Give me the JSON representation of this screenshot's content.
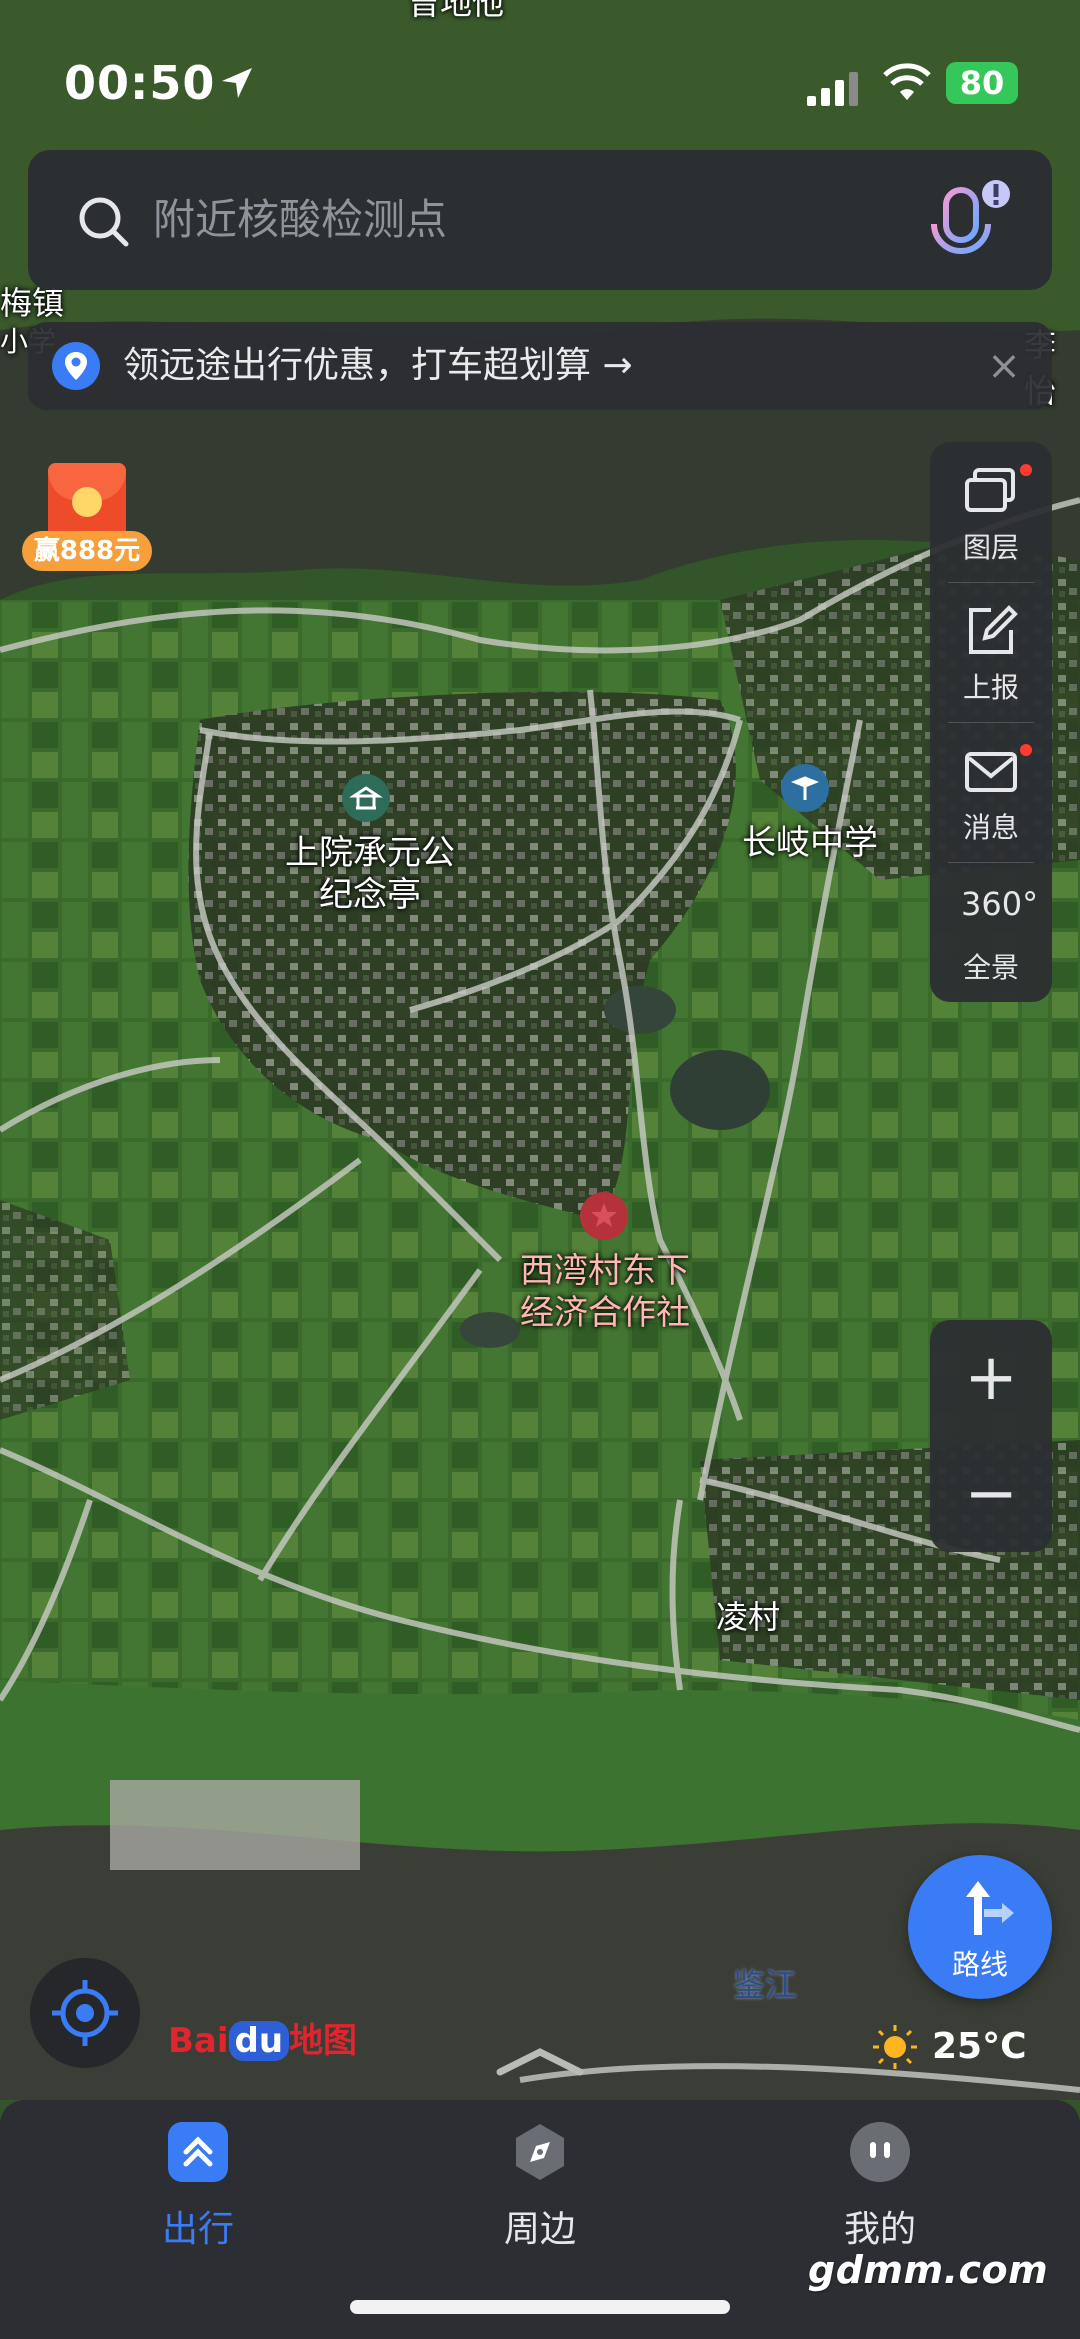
{
  "status_bar": {
    "time": "00:50",
    "battery": "80"
  },
  "search": {
    "placeholder": "附近核酸检测点"
  },
  "promo": {
    "text": "领远途出行优惠，打车超划算 →",
    "close": "×"
  },
  "redpacket": {
    "label": "赢888元"
  },
  "map_tools": [
    {
      "label": "图层",
      "icon": "layers-icon",
      "badge": true
    },
    {
      "label": "上报",
      "icon": "report-edit-icon",
      "badge": false
    },
    {
      "label": "消息",
      "icon": "message-envelope-icon",
      "badge": true
    },
    {
      "label": "全景",
      "icon": "panorama-360-icon",
      "badge": false,
      "icon_text": "360°"
    }
  ],
  "zoom": {
    "in": "+",
    "out": "−"
  },
  "map": {
    "labels": {
      "top_partial": "曾地他",
      "left_town": "梅镇",
      "left_partial": "小学",
      "right_partial": "李怡",
      "village": "凌村",
      "river": "鉴江"
    },
    "pois": [
      {
        "name_line1": "上院承元公",
        "name_line2": "纪念亭",
        "kind": "pavilion"
      },
      {
        "name_line1": "长岐中学",
        "name_line2": "",
        "kind": "school"
      },
      {
        "name_line1": "西湾村东下",
        "name_line2": "经济合作社",
        "kind": "office"
      }
    ],
    "watermark_small": "©Baidu"
  },
  "route_button": {
    "label": "路线"
  },
  "weather": {
    "temp": "25°C",
    "icon": "sun-icon"
  },
  "logo": {
    "text1": "Bai",
    "text2": "du",
    "text3": "地图"
  },
  "tabs": [
    {
      "label": "出行",
      "icon": "travel-icon",
      "active": true
    },
    {
      "label": "周边",
      "icon": "compass-icon",
      "active": false
    },
    {
      "label": "我的",
      "icon": "profile-icon",
      "active": false
    }
  ],
  "watermark": "gdmm.com",
  "colors": {
    "accent": "#3a7cf5",
    "active_tab": "#3a7cf5",
    "badge": "#ff3b30",
    "battery": "#35c759"
  }
}
